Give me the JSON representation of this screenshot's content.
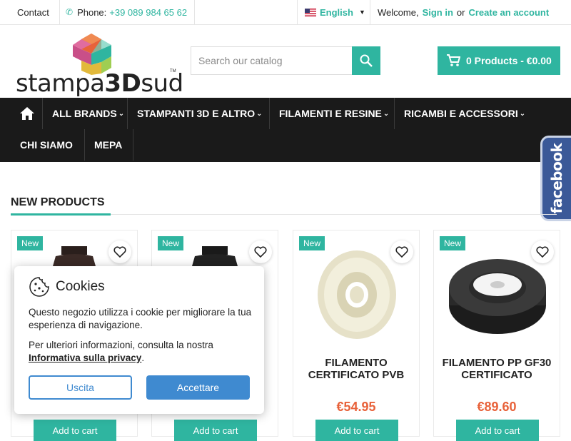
{
  "topbar": {
    "contact": "Contact",
    "phone_label": "Phone:",
    "phone_number": "+39 089 984 65 62",
    "language": "English",
    "welcome": "Welcome,",
    "sign_in": "Sign in",
    "or": "or",
    "create_account": "Create an account"
  },
  "logo": {
    "text_left": "stampa",
    "text_mid": "3D",
    "text_right": "sud",
    "trademark": "TM"
  },
  "search": {
    "placeholder": "Search our catalog",
    "icon": "search-icon"
  },
  "cart": {
    "label": "0 Products - €0.00",
    "icon": "cart-icon"
  },
  "nav": {
    "home_icon": "home-icon",
    "items": [
      {
        "label": "ALL BRANDS"
      },
      {
        "label": "STAMPANTI 3D E ALTRO"
      },
      {
        "label": "FILAMENTI E RESINE"
      },
      {
        "label": "RICAMBI E ACCESSORI"
      },
      {
        "label": "CHI SIAMO"
      },
      {
        "label": "MEPA"
      }
    ]
  },
  "facebook": {
    "label": "facebook"
  },
  "section": {
    "title": "NEW PRODUCTS"
  },
  "products": [
    {
      "badge": "New",
      "name": "",
      "price": "",
      "add": "Add to cart"
    },
    {
      "badge": "New",
      "name": "",
      "price": "",
      "add": "Add to cart"
    },
    {
      "badge": "New",
      "name": "FILAMENTO CERTIFICATO PVB",
      "price": "€54.95",
      "add": "Add to cart"
    },
    {
      "badge": "New",
      "name": "FILAMENTO PP GF30 CERTIFICATO",
      "price": "€89.60",
      "add": "Add to cart"
    }
  ],
  "cookies": {
    "title": "Cookies",
    "text1": "Questo negozio utilizza i cookie per migliorare la tua esperienza di navigazione.",
    "text2_prefix": "Per ulteriori informazioni, consulta la nostra",
    "privacy_link": "Informativa sulla privacy",
    "text2_suffix": ".",
    "decline": "Uscita",
    "accept": "Accettare"
  },
  "colors": {
    "accent": "#2fb5a0",
    "price": "#e8623a",
    "nav_bg": "#1a1a1a",
    "cookie_button": "#3f8ad0",
    "facebook": "#3b5998"
  }
}
